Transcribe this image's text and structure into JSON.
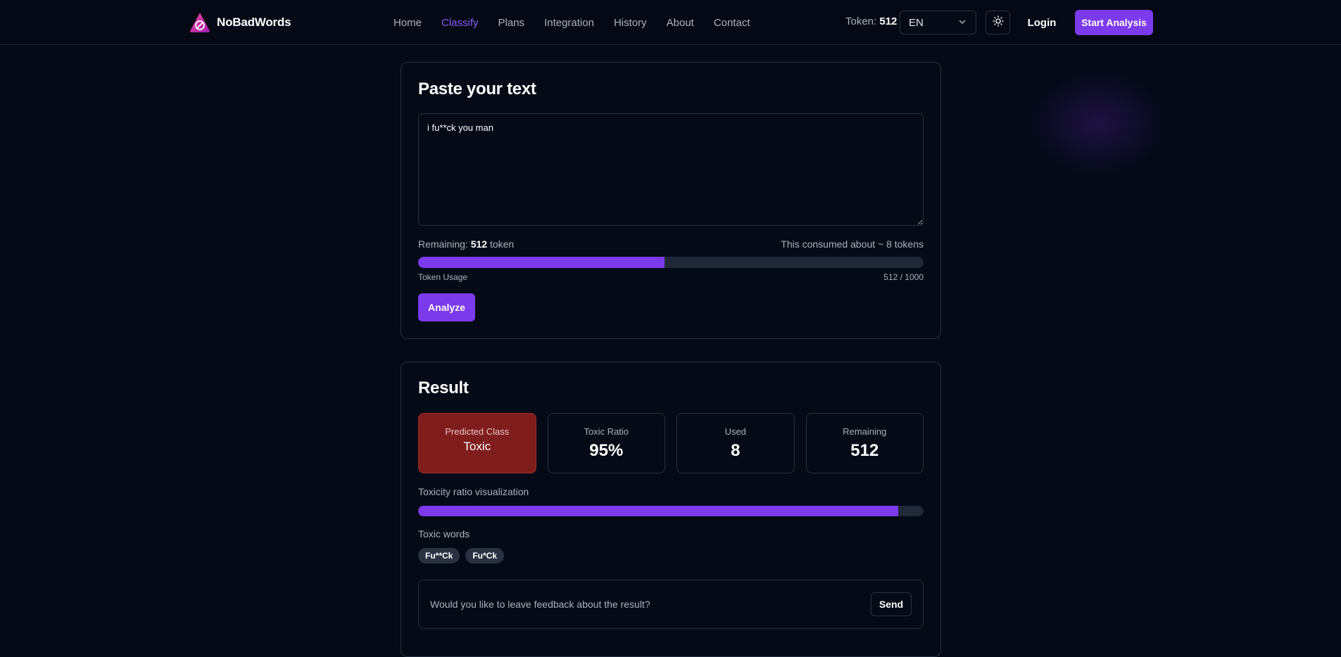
{
  "header": {
    "brand": "NoBadWords",
    "nav": [
      {
        "label": "Home",
        "active": false
      },
      {
        "label": "Classify",
        "active": true
      },
      {
        "label": "Plans",
        "active": false
      },
      {
        "label": "Integration",
        "active": false
      },
      {
        "label": "History",
        "active": false
      },
      {
        "label": "About",
        "active": false
      },
      {
        "label": "Contact",
        "active": false
      }
    ],
    "token_label": "Token:",
    "token_value": "512",
    "language": "EN",
    "login_label": "Login",
    "start_label": "Start Analysis"
  },
  "input_card": {
    "title": "Paste your text",
    "text_value": "i fu**ck you man",
    "remaining_prefix": "Remaining:",
    "remaining_value": "512",
    "remaining_suffix": "token",
    "consumed_text": "This consumed about ~ 8 tokens",
    "usage_label": "Token Usage",
    "usage_value": "512 / 1000",
    "usage_fraction": 0.488,
    "analyze_label": "Analyze"
  },
  "result_card": {
    "title": "Result",
    "stats": {
      "predicted": {
        "label": "Predicted Class",
        "value": "Toxic"
      },
      "ratio": {
        "label": "Toxic Ratio",
        "value": "95%"
      },
      "used": {
        "label": "Used",
        "value": "8"
      },
      "remaining": {
        "label": "Remaining",
        "value": "512"
      }
    },
    "ratio_viz_label": "Toxicity ratio visualization",
    "ratio_fraction": 0.95,
    "toxic_words_label": "Toxic words",
    "toxic_words": [
      "Fu**Ck",
      "Fu*Ck"
    ],
    "feedback_prompt": "Would you like to leave feedback about the result?",
    "send_label": "Send"
  },
  "colors": {
    "accent": "#7c3aed",
    "active_nav": "#8b5cf6",
    "toxic": "#7f1d1d",
    "background": "#050a17"
  },
  "icons": {
    "brand": "nobadwords-logo-icon",
    "language": "chevron-down-icon",
    "theme": "sun-icon"
  }
}
